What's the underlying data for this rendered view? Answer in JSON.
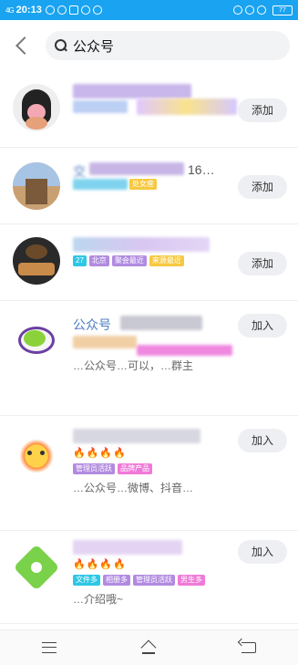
{
  "status_bar": {
    "signal": "4G",
    "time": "20:13",
    "battery": "77"
  },
  "search": {
    "query": "公众号"
  },
  "results": [
    {
      "action": "添加",
      "name": "",
      "count": "",
      "tags": [],
      "desc": ""
    },
    {
      "action": "添加",
      "name": "交",
      "count": "16…",
      "tags": [
        "处女座"
      ],
      "desc": ""
    },
    {
      "action": "添加",
      "name": "",
      "count": "",
      "tags": [
        "27",
        "北京",
        "聚会最近",
        "来源最近"
      ],
      "desc": ""
    },
    {
      "action": "加入",
      "name": "公众号",
      "count": "",
      "tags": [],
      "desc": "…公众号…可以，…群主",
      "desc2": "可"
    },
    {
      "action": "加入",
      "name": "",
      "count": "",
      "tags": [
        "管理员活跃",
        "品牌产品"
      ],
      "desc": "…公众号…微博、抖音…",
      "desc2": ""
    },
    {
      "action": "加入",
      "name": "",
      "count": "",
      "tags": [
        "文件多",
        "相册多",
        "管理员活跃",
        "男生多"
      ],
      "desc": "…介绍哦~"
    }
  ],
  "colors": {
    "status_bar_bg": "#1aa3f0",
    "name_blue": "#4d7dc0",
    "tag_cyan": "#2ec7e6",
    "tag_pink": "#f07ad8",
    "tag_yellow": "#f7c940",
    "tag_purple": "#b18be0",
    "flame": "#ff7a22"
  },
  "icons": {
    "back": "back-arrow-icon",
    "search": "search-icon",
    "nav_menu": "menu-icon",
    "nav_home": "home-icon",
    "nav_back": "back-icon"
  }
}
